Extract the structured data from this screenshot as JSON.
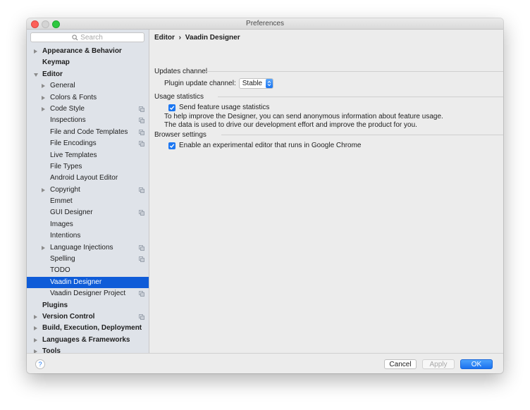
{
  "window": {
    "title": "Preferences"
  },
  "sidebar": {
    "search_placeholder": "Search",
    "items": [
      {
        "label": "Appearance & Behavior",
        "level": 0,
        "arrow": "right",
        "icon": false
      },
      {
        "label": "Keymap",
        "level": 0,
        "arrow": "none",
        "icon": false
      },
      {
        "label": "Editor",
        "level": 0,
        "arrow": "down",
        "icon": false
      },
      {
        "label": "General",
        "level": 1,
        "arrow": "right",
        "icon": false
      },
      {
        "label": "Colors & Fonts",
        "level": 1,
        "arrow": "right",
        "icon": false
      },
      {
        "label": "Code Style",
        "level": 1,
        "arrow": "right",
        "icon": true
      },
      {
        "label": "Inspections",
        "level": 1,
        "arrow": "none",
        "icon": true
      },
      {
        "label": "File and Code Templates",
        "level": 1,
        "arrow": "none",
        "icon": true
      },
      {
        "label": "File Encodings",
        "level": 1,
        "arrow": "none",
        "icon": true
      },
      {
        "label": "Live Templates",
        "level": 1,
        "arrow": "none",
        "icon": false
      },
      {
        "label": "File Types",
        "level": 1,
        "arrow": "none",
        "icon": false
      },
      {
        "label": "Android Layout Editor",
        "level": 1,
        "arrow": "none",
        "icon": false
      },
      {
        "label": "Copyright",
        "level": 1,
        "arrow": "right",
        "icon": true
      },
      {
        "label": "Emmet",
        "level": 1,
        "arrow": "none",
        "icon": false
      },
      {
        "label": "GUI Designer",
        "level": 1,
        "arrow": "none",
        "icon": true
      },
      {
        "label": "Images",
        "level": 1,
        "arrow": "none",
        "icon": false
      },
      {
        "label": "Intentions",
        "level": 1,
        "arrow": "none",
        "icon": false
      },
      {
        "label": "Language Injections",
        "level": 1,
        "arrow": "right",
        "icon": true
      },
      {
        "label": "Spelling",
        "level": 1,
        "arrow": "none",
        "icon": true
      },
      {
        "label": "TODO",
        "level": 1,
        "arrow": "none",
        "icon": false
      },
      {
        "label": "Vaadin Designer",
        "level": 1,
        "arrow": "none",
        "icon": false,
        "selected": true
      },
      {
        "label": "Vaadin Designer Project",
        "level": 1,
        "arrow": "none",
        "icon": true
      },
      {
        "label": "Plugins",
        "level": 0,
        "arrow": "none",
        "icon": false
      },
      {
        "label": "Version Control",
        "level": 0,
        "arrow": "right",
        "icon": true
      },
      {
        "label": "Build, Execution, Deployment",
        "level": 0,
        "arrow": "right",
        "icon": false
      },
      {
        "label": "Languages & Frameworks",
        "level": 0,
        "arrow": "right",
        "icon": false
      },
      {
        "label": "Tools",
        "level": 0,
        "arrow": "right",
        "icon": false
      }
    ]
  },
  "content": {
    "breadcrumb": {
      "parent": "Editor",
      "separator": "›",
      "current": "Vaadin Designer"
    },
    "updates": {
      "title": "Updates channel",
      "channel_label": "Plugin update channel:",
      "channel_value": "Stable"
    },
    "usage": {
      "title": "Usage statistics",
      "checkbox_label": "Send feature usage statistics",
      "checked": true,
      "desc_line1": "To help improve the Designer, you can send anonymous information about feature usage.",
      "desc_line2": "The data is used to drive our development effort and improve the product for you."
    },
    "browser": {
      "title": "Browser settings",
      "checkbox_label": "Enable an experimental editor that runs in Google Chrome",
      "checked": true
    }
  },
  "footer": {
    "help": "?",
    "cancel": "Cancel",
    "apply": "Apply",
    "ok": "OK"
  },
  "colors": {
    "accent": "#1c77f2",
    "selection": "#0f5cd8",
    "sidebar_bg": "#dfe3e9",
    "close": "#fc5f57",
    "maximize": "#2dc840"
  }
}
